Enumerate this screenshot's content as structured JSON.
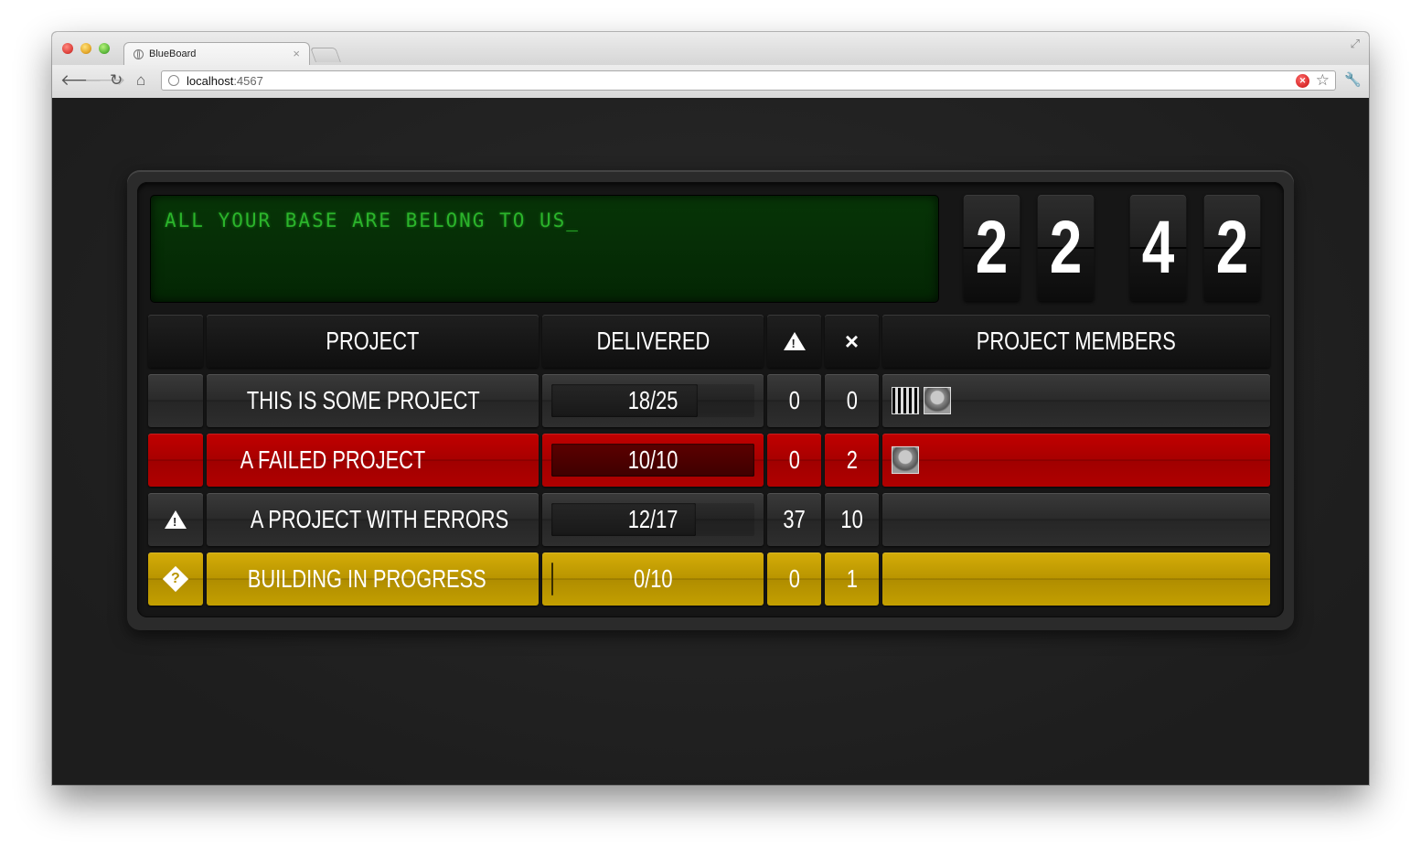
{
  "browser": {
    "tab_title": "BlueBoard",
    "tab_close": "×",
    "url_host": "localhost",
    "url_port": ":4567",
    "icons": [
      "back-arrow-icon",
      "forward-arrow-icon",
      "reload-icon",
      "home-icon",
      "globe-icon",
      "extension-icon",
      "star-icon",
      "wrench-icon",
      "fullscreen-icon"
    ]
  },
  "board": {
    "message": "ALL YOUR BASE ARE BELONG TO US_",
    "clock_digits": [
      "2",
      "2",
      "4",
      "2"
    ],
    "headers": {
      "project": "PROJECT",
      "delivered": "DELIVERED",
      "members": "PROJECT MEMBERS"
    },
    "rows": [
      {
        "status": "default",
        "name": "THIS IS SOME PROJECT",
        "delivered": "18/25",
        "progress": 0.72,
        "warnings": "0",
        "failures": "0",
        "members": 2
      },
      {
        "status": "failed",
        "name": "A FAILED PROJECT",
        "delivered": "10/10",
        "progress": 1.0,
        "warnings": "0",
        "failures": "2",
        "members": 1
      },
      {
        "status": "errors",
        "name": "A PROJECT WITH ERRORS",
        "delivered": "12/17",
        "progress": 0.71,
        "warnings": "37",
        "failures": "10",
        "members": 0
      },
      {
        "status": "building",
        "name": "BUILDING IN PROGRESS",
        "delivered": "0/10",
        "progress": 0.0,
        "warnings": "0",
        "failures": "1",
        "members": 0
      }
    ],
    "colors": {
      "failed": "#b00000",
      "building": "#c39f00",
      "lcd_text": "#2bb42b"
    }
  }
}
